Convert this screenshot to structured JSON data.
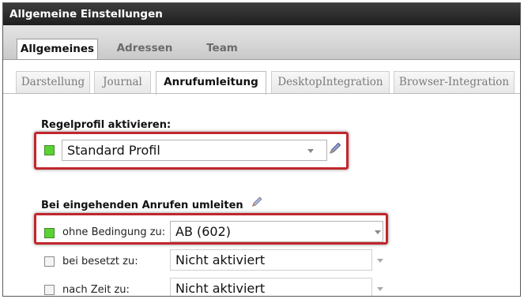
{
  "window": {
    "title": "Allgemeine Einstellungen"
  },
  "tabs_main": [
    {
      "label": "Allgemeines",
      "active": true
    },
    {
      "label": "Adressen",
      "active": false
    },
    {
      "label": "Team",
      "active": false
    }
  ],
  "tabs_sub": [
    {
      "label": "Darstellung",
      "active": false
    },
    {
      "label": "Journal",
      "active": false
    },
    {
      "label": "Anrufumleitung",
      "active": true
    },
    {
      "label": "DesktopIntegration",
      "active": false
    },
    {
      "label": "Browser-Integration",
      "active": false
    }
  ],
  "profile": {
    "heading": "Regelprofil aktivieren:",
    "checked": true,
    "value": "Standard Profil"
  },
  "forwarding": {
    "heading": "Bei eingehenden Anrufen umleiten",
    "rules": [
      {
        "label": "ohne Bedingung zu:",
        "value": "AB (602)",
        "checked": true
      },
      {
        "label": "bei besetzt zu:",
        "value": "Nicht aktiviert",
        "checked": false
      },
      {
        "label": "nach Zeit zu:",
        "value": "Nicht aktiviert",
        "checked": false
      }
    ]
  },
  "colors": {
    "highlight": "#c1272d",
    "checkbox_on": "#5bd233"
  },
  "icons": {
    "edit": "pencil-icon",
    "dropdown": "chevron-down-icon"
  }
}
